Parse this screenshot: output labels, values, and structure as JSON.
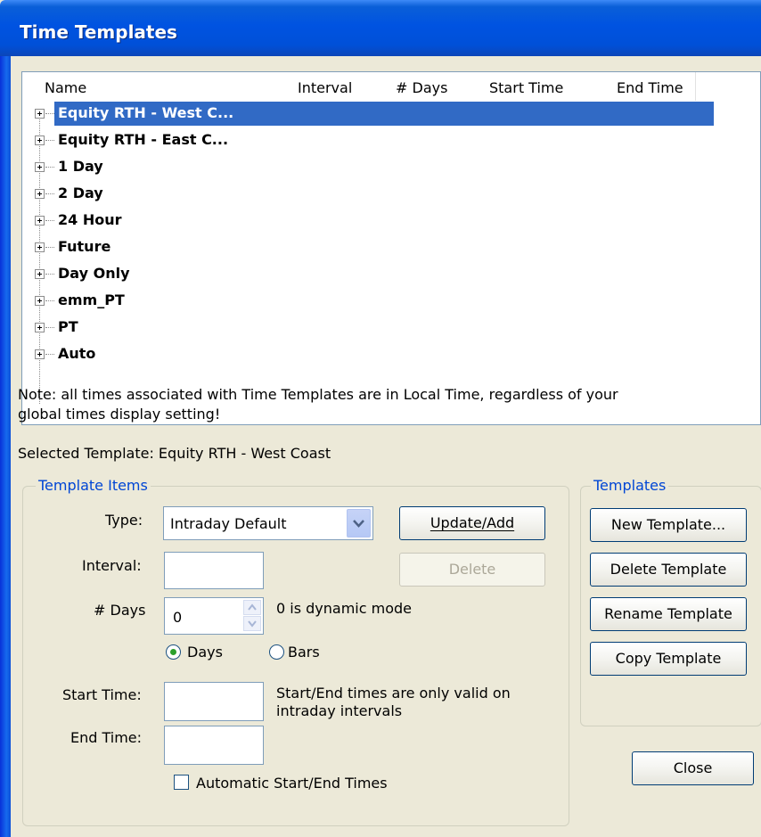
{
  "window": {
    "title": "Time Templates"
  },
  "list": {
    "columns": [
      "Name",
      "Interval",
      "# Days",
      "Start Time",
      "End Time"
    ],
    "rows": [
      "Equity RTH - West C...",
      "Equity RTH - East C...",
      "1 Day",
      "2 Day",
      "24 Hour",
      "Future",
      "Day Only",
      "emm_PT",
      "PT",
      "Auto"
    ],
    "selected_index": 0
  },
  "note": {
    "line1": "Note: all times associated with Time Templates are in Local Time, regardless of your",
    "line2": "global times display setting!"
  },
  "selected_template": "Selected Template: Equity RTH - West Coast",
  "template_items": {
    "title": "Template Items",
    "type_label": "Type:",
    "type_value": "Intraday Default",
    "interval_label": "Interval:",
    "interval_value": "",
    "days_label": "# Days",
    "days_value": "0",
    "days_hint": "0 is dynamic mode",
    "radio_days": "Days",
    "radio_bars": "Bars",
    "radio_selected": "Days",
    "start_label": "Start Time:",
    "start_value": "",
    "end_label": "End Time:",
    "end_value": "",
    "time_hint_1": "Start/End times are only valid on",
    "time_hint_2": "intraday intervals",
    "auto_label": "Automatic Start/End Times",
    "auto_checked": false,
    "update_add": "Update/Add",
    "delete": "Delete"
  },
  "templates": {
    "title": "Templates",
    "new": "New Template...",
    "delete": "Delete Template",
    "rename": "Rename Template",
    "copy": "Copy Template"
  },
  "close": "Close"
}
